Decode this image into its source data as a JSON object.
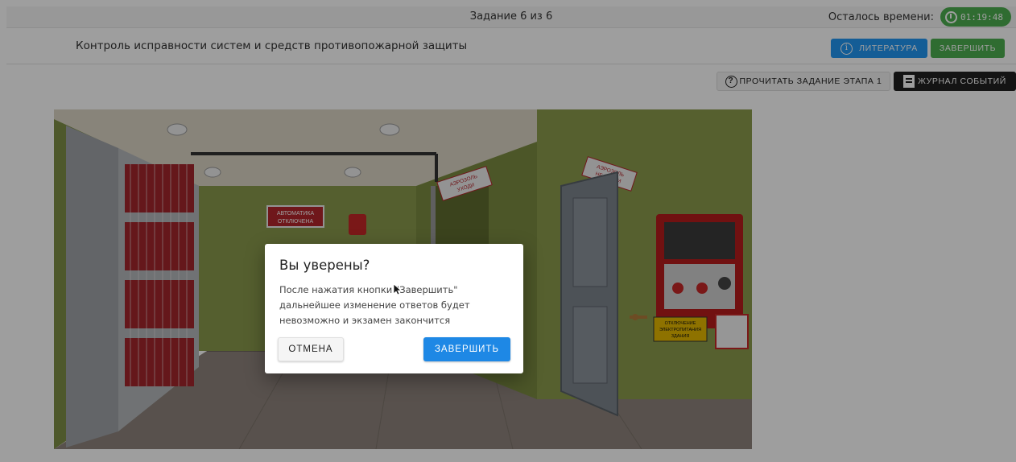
{
  "topbar": {
    "task_counter": "Задание 6 из 6",
    "timer_label": "Осталось времени:",
    "timer_value": "01:19:48",
    "timer_color": "#4caf50"
  },
  "header": {
    "title": "Контроль исправности систем и средств противопожарной защиты",
    "literature_button": "ЛИТЕРАТУРА",
    "finish_button": "ЗАВЕРШИТЬ"
  },
  "toolbar": {
    "read_task_button": "ПРОЧИТАТЬ ЗАДАНИЕ ЭТАПА 1",
    "event_log_button": "ЖУРНАЛ СОБЫТИЙ"
  },
  "scene": {
    "sign_automation_line1": "АВТОМАТИКА",
    "sign_automation_line2": "ОТКЛЮЧЕНА",
    "sign_aerosol_left_line1": "АЭРОЗОЛЬ",
    "sign_aerosol_left_line2": "УХОДИ",
    "sign_aerosol_right_line1": "АЭРОЗОЛЬ",
    "sign_aerosol_right_line2": "НЕ ВХОДИ",
    "sign_power_line1": "ОТКЛЮЧЕНИЕ",
    "sign_power_line2": "ЭЛЕКТРОПИТАНИЯ",
    "sign_power_line3": "ЗДАНИЯ"
  },
  "dialog": {
    "title": "Вы уверены?",
    "message": "После нажатия кнопки \"Завершить\" дальнейшее изменение ответов будет невозможно и экзамен закончится",
    "cancel_button": "ОТМЕНА",
    "confirm_button": "ЗАВЕРШИТЬ"
  },
  "colors": {
    "primary": "#2196f3",
    "success": "#4caf50",
    "dark": "#212121"
  }
}
